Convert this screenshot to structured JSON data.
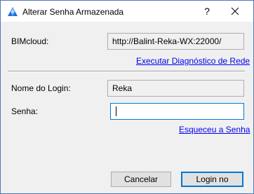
{
  "window": {
    "title": "Alterar Senha Armazenada",
    "help_symbol": "?",
    "icons": {
      "app": "bimcloud-logo-icon",
      "close": "close-icon"
    }
  },
  "bimcloud": {
    "label": "BIMcloud:",
    "value": "http://Balint-Reka-WX:22000/",
    "diagnostics_link": "Executar Diagnóstico de Rede"
  },
  "login": {
    "username_label": "Nome do Login:",
    "username_value": "Reka",
    "password_label": "Senha:",
    "password_value": "",
    "forgot_link": "Esqueceu a Senha"
  },
  "buttons": {
    "cancel": "Cancelar",
    "login": "Login no"
  },
  "colors": {
    "link": "#0000ee",
    "focus_border": "#0078d7",
    "dialog_bg": "#f0f0f0"
  }
}
